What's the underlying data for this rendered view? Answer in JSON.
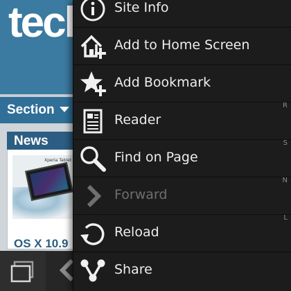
{
  "webpage": {
    "logo_text": "tech",
    "section_label": "Section",
    "news_label": "News",
    "thumb_caption": "Xperia Tablet",
    "headline_fragment": "OS X 10.9"
  },
  "menu": {
    "items": [
      {
        "label": "Site Info",
        "icon": "info-icon",
        "shortcut": "",
        "enabled": true
      },
      {
        "label": "Add to Home Screen",
        "icon": "add-to-home-icon",
        "shortcut": "",
        "enabled": true
      },
      {
        "label": "Add Bookmark",
        "icon": "add-bookmark-star-icon",
        "shortcut": "",
        "enabled": true
      },
      {
        "label": "Reader",
        "icon": "reader-document-icon",
        "shortcut": "R",
        "enabled": true
      },
      {
        "label": "Find on Page",
        "icon": "magnifier-icon",
        "shortcut": "S",
        "enabled": true
      },
      {
        "label": "Forward",
        "icon": "forward-chevron-icon",
        "shortcut": "N",
        "enabled": false
      },
      {
        "label": "Reload",
        "icon": "reload-icon",
        "shortcut": "L",
        "enabled": true
      },
      {
        "label": "Share",
        "icon": "share-icon",
        "shortcut": "",
        "enabled": true
      }
    ]
  },
  "action_bar": {
    "tabs_icon": "tabs-icon",
    "back_icon": "back-chevron-icon"
  },
  "colors": {
    "menu_background": "#1c1c1c",
    "menu_text": "#ededed",
    "disabled_text": "#6f6f6f",
    "site_header_blue": "#3b7aa1",
    "action_bar": "#262626"
  }
}
